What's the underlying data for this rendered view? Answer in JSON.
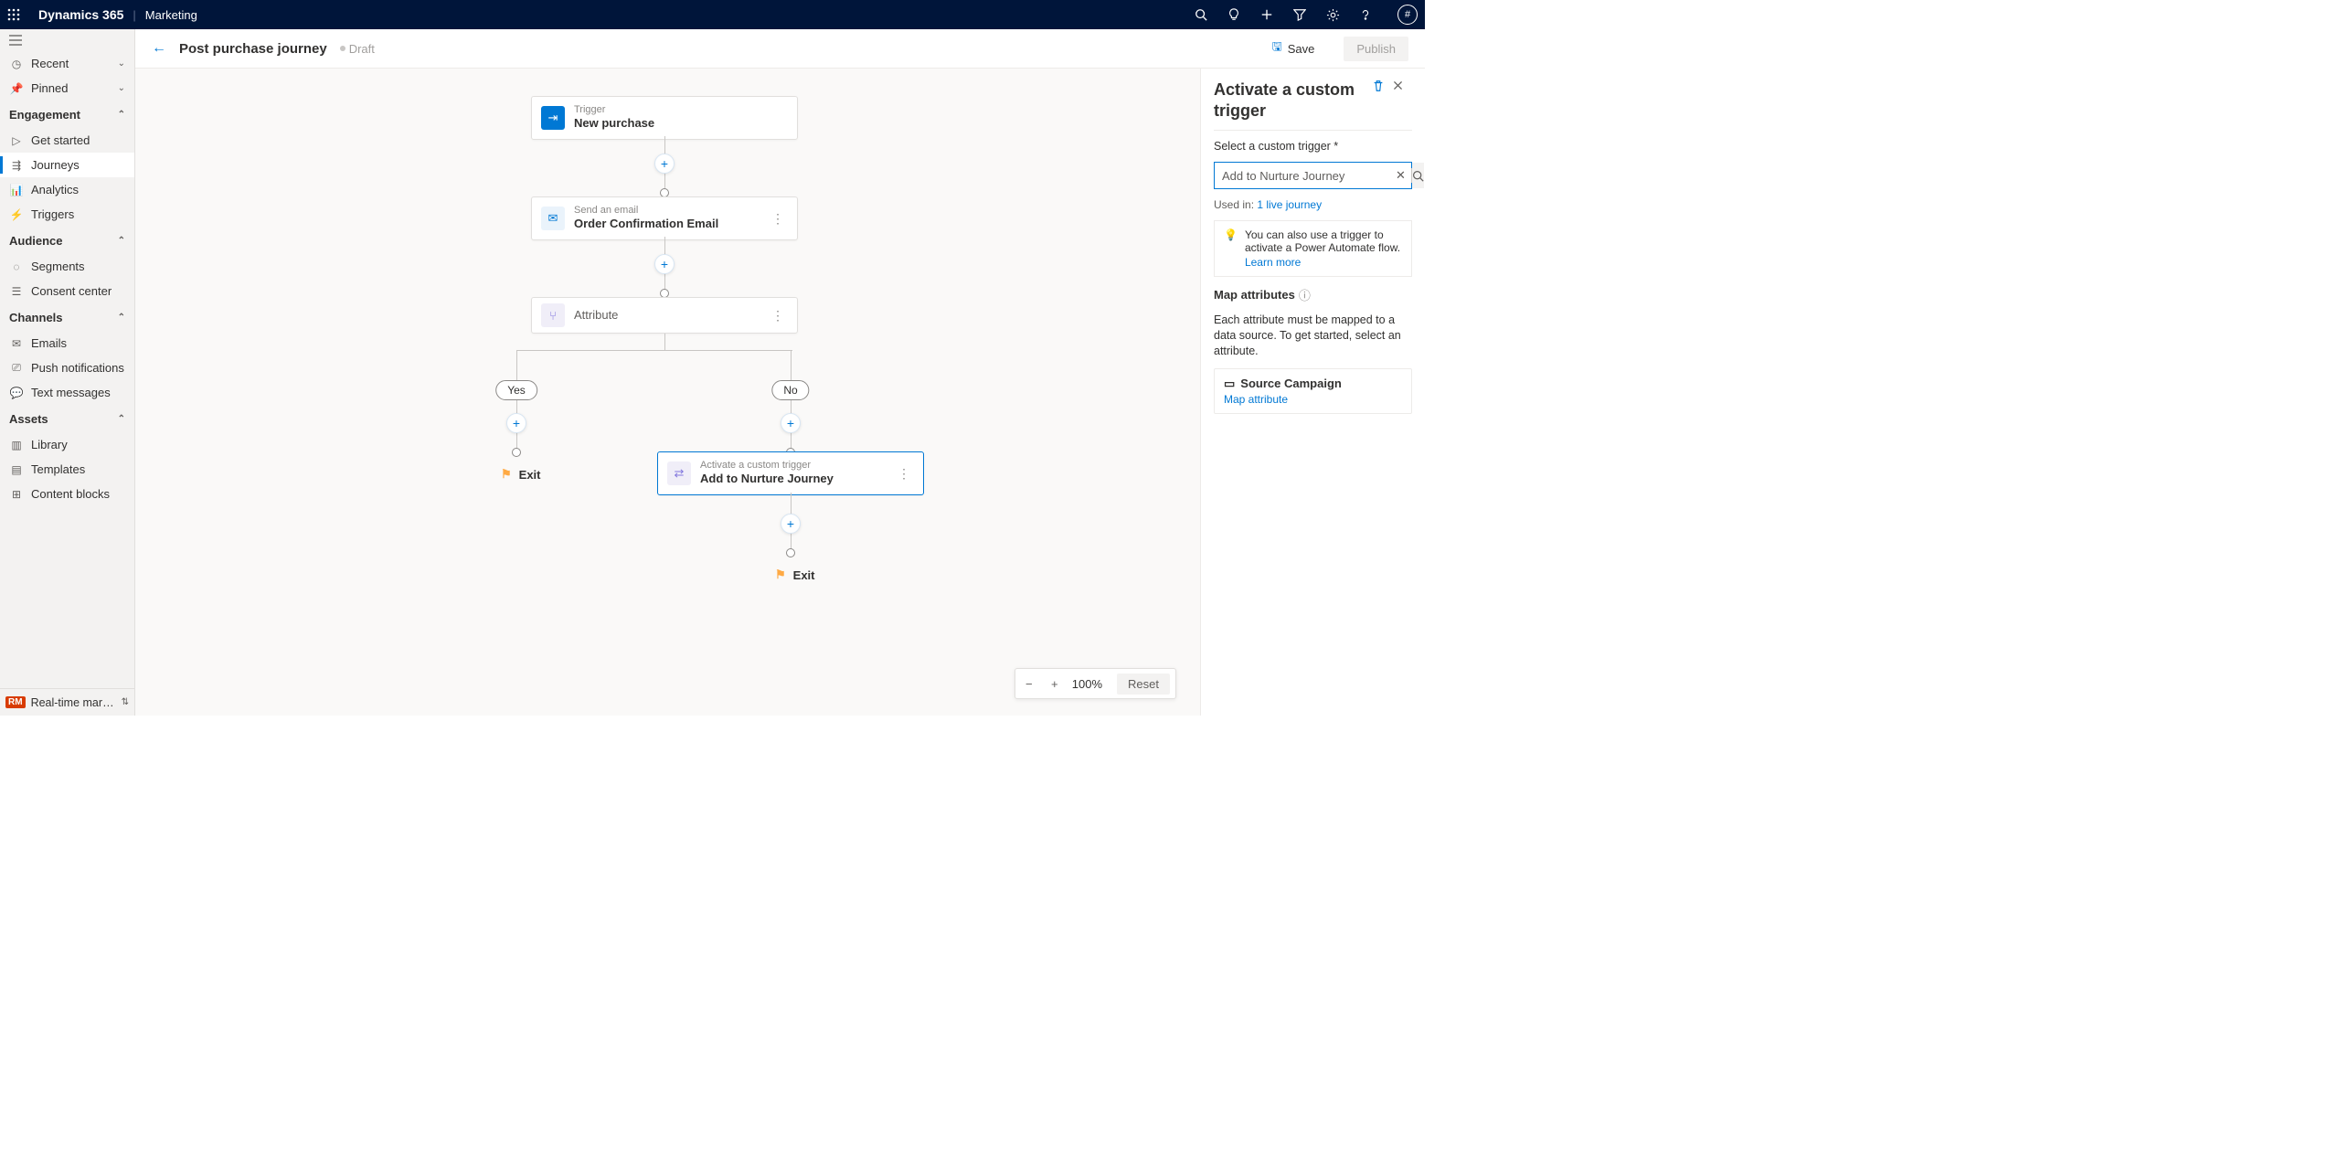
{
  "header": {
    "brand": "Dynamics 365",
    "app": "Marketing"
  },
  "page": {
    "title": "Post purchase journey",
    "status": "Draft",
    "save": "Save",
    "publish": "Publish"
  },
  "nav": {
    "recent": "Recent",
    "pinned": "Pinned",
    "sections": {
      "engagement": {
        "label": "Engagement",
        "items": [
          "Get started",
          "Journeys",
          "Analytics",
          "Triggers"
        ]
      },
      "audience": {
        "label": "Audience",
        "items": [
          "Segments",
          "Consent center"
        ]
      },
      "channels": {
        "label": "Channels",
        "items": [
          "Emails",
          "Push notifications",
          "Text messages"
        ]
      },
      "assets": {
        "label": "Assets",
        "items": [
          "Library",
          "Templates",
          "Content blocks"
        ]
      }
    },
    "footer": {
      "badge": "RM",
      "label": "Real-time marketi..."
    }
  },
  "cards": {
    "trigger": {
      "sup": "Trigger",
      "main": "New purchase"
    },
    "email": {
      "sup": "Send an email",
      "main": "Order Confirmation Email"
    },
    "attr": {
      "main": "Attribute"
    },
    "custom": {
      "sup": "Activate a custom trigger",
      "main": "Add to Nurture Journey"
    }
  },
  "branch": {
    "yes": "Yes",
    "no": "No",
    "exit": "Exit"
  },
  "zoom": {
    "value": "100%",
    "reset": "Reset"
  },
  "panel": {
    "title": "Activate a custom trigger",
    "select_label": "Select a custom trigger *",
    "select_value": "Add to Nurture Journey",
    "used_in_label": "Used in:",
    "used_in_link": "1 live journey",
    "info": "You can also use a trigger to activate a Power Automate flow.",
    "learn_more": "Learn more",
    "map_title": "Map attributes",
    "map_desc": "Each attribute must be mapped to a data source. To get started, select an attribute.",
    "attr_name": "Source Campaign",
    "map_link": "Map attribute"
  }
}
